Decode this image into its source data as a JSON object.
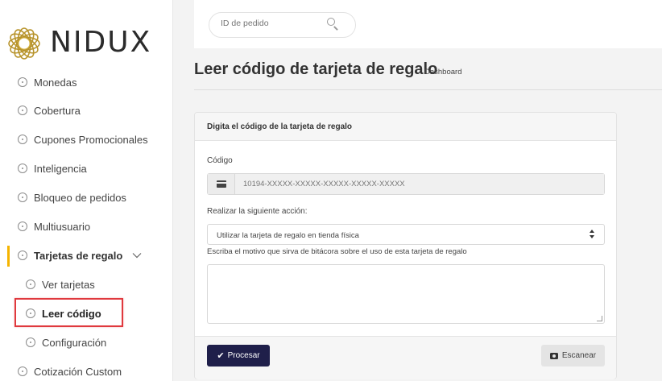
{
  "brand": {
    "name": "NIDUX"
  },
  "colors": {
    "accent": "#f5b400",
    "primary_button": "#1f1f4a",
    "highlight": "#e0393e"
  },
  "sidebar": {
    "items": [
      {
        "label": "Monedas",
        "icon": "circle-dot-icon"
      },
      {
        "label": "Cobertura",
        "icon": "circle-dot-icon"
      },
      {
        "label": "Cupones Promocionales",
        "icon": "circle-dot-icon"
      },
      {
        "label": "Inteligencia",
        "icon": "circle-dot-icon"
      },
      {
        "label": "Bloqueo de pedidos",
        "icon": "circle-dot-icon"
      },
      {
        "label": "Multiusuario",
        "icon": "circle-dot-icon"
      },
      {
        "label": "Tarjetas de regalo",
        "icon": "circle-dot-icon",
        "expanded": true,
        "chevron": "chevron-down-icon"
      },
      {
        "label": "Ver tarjetas",
        "icon": "circle-dot-icon",
        "sub": true
      },
      {
        "label": "Leer código",
        "icon": "circle-dot-icon",
        "sub": true,
        "current": true
      },
      {
        "label": "Configuración",
        "icon": "circle-dot-icon",
        "sub": true
      },
      {
        "label": "Cotización Custom",
        "icon": "circle-dot-icon"
      }
    ]
  },
  "search": {
    "placeholder": "ID de pedido",
    "icon": "search-icon"
  },
  "page": {
    "title": "Leer código de tarjeta de regalo",
    "breadcrumb": "Dashboard"
  },
  "card": {
    "header": "Digita el código de la tarjeta de regalo",
    "code_label": "Código",
    "code_placeholder": "10194-XXXXX-XXXXX-XXXXX-XXXXX-XXXXX",
    "action_label": "Realizar la siguiente acción:",
    "action_selected": "Utilizar la tarjeta de regalo en tienda física",
    "reason_label": "Escriba el motivo que sirva de bitácora sobre el uso de esta tarjeta de regalo",
    "reason_value": "",
    "process_button": "Procesar",
    "scan_button": "Escanear"
  }
}
